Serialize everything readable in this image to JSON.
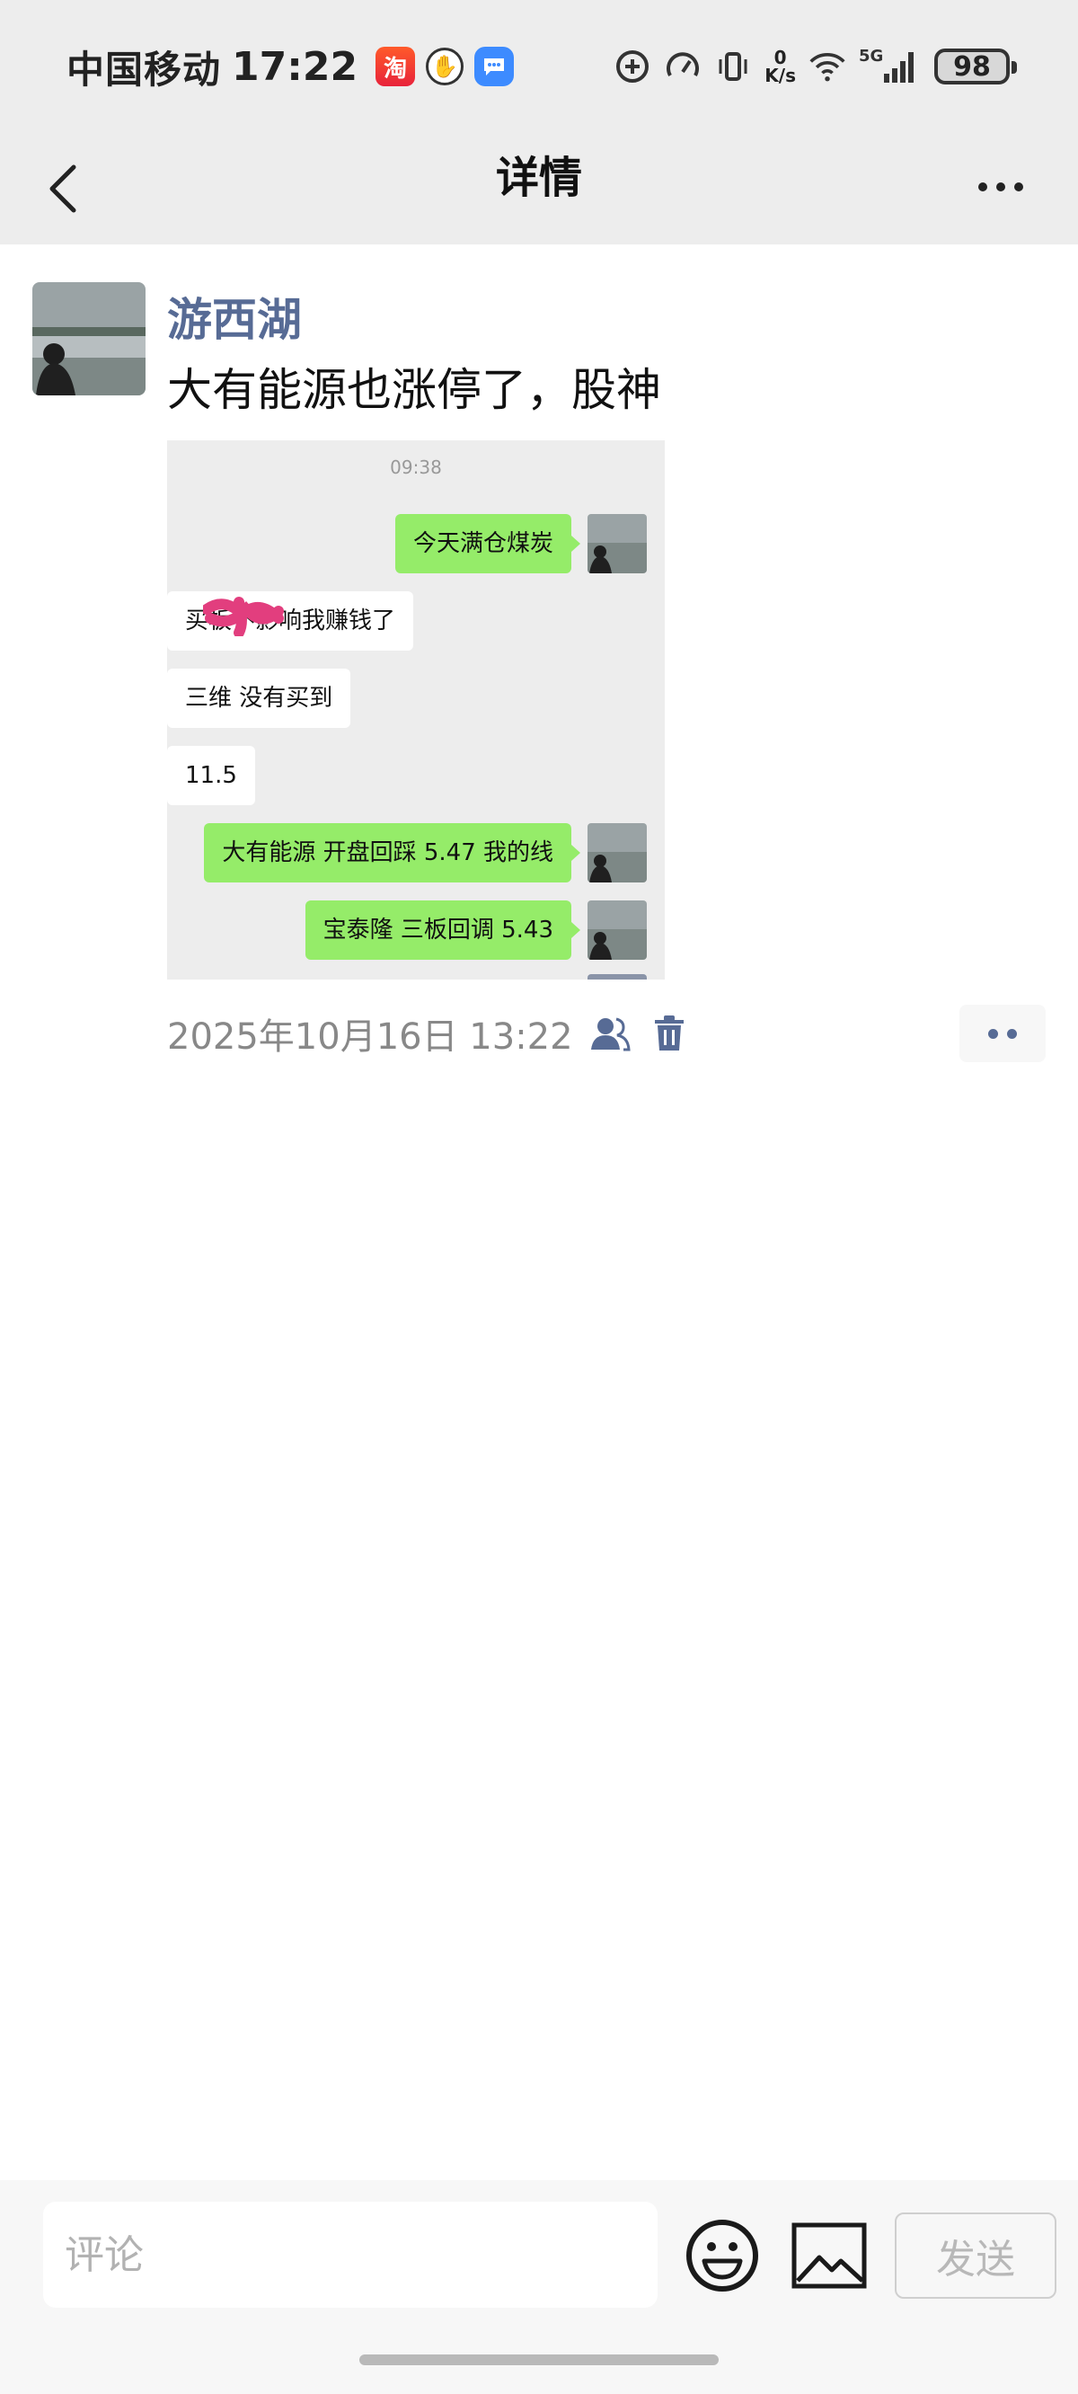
{
  "status_bar": {
    "carrier": "中国移动",
    "time": "17:22",
    "taobao_badge": "淘",
    "net_speed_value": "0",
    "net_speed_unit": "K/s",
    "network": "5G",
    "battery": "98"
  },
  "nav": {
    "title": "详情"
  },
  "post": {
    "author": "游西湖",
    "text": "大有能源也涨停了，股神",
    "date": "2025年10月16日 13:22",
    "screenshot": {
      "time": "09:38",
      "messages": [
        {
          "side": "me",
          "text": "今天满仓煤炭"
        },
        {
          "side": "other",
          "text": "买板不影响我赚钱了"
        },
        {
          "side": "other",
          "text": "三维 没有买到"
        },
        {
          "side": "other",
          "text": "11.5"
        },
        {
          "side": "me",
          "text": "大有能源 开盘回踩 5.47 我的线"
        },
        {
          "side": "me",
          "text": "宝泰隆 三板回调 5.43"
        }
      ]
    }
  },
  "comment_bar": {
    "placeholder": "评论",
    "send_label": "发送"
  },
  "colors": {
    "author_blue": "#576b95",
    "bubble_green": "#95ec69",
    "bar_gray": "#ededed"
  }
}
